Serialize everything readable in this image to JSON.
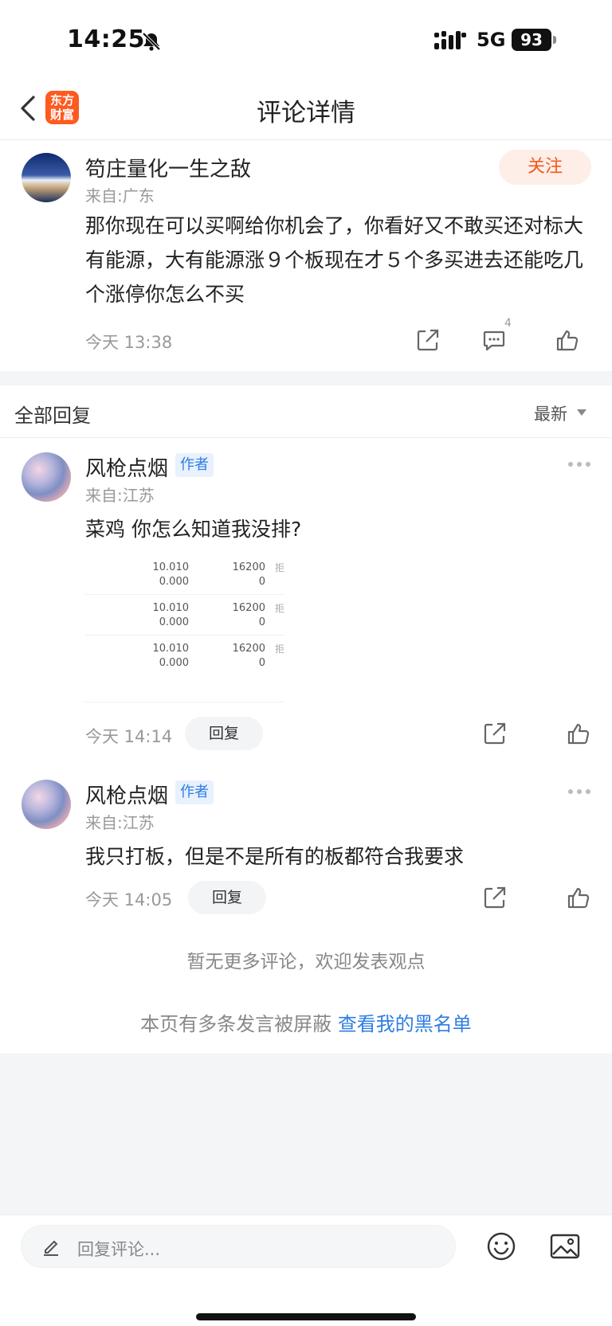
{
  "status_bar": {
    "time": "14:25",
    "network": "5G",
    "battery": "93"
  },
  "nav": {
    "title": "评论详情",
    "logo_line1": "东方",
    "logo_line2": "财富"
  },
  "post": {
    "author": "笱庄量化一生之敌",
    "location": "来自:广东",
    "follow_label": "关注",
    "content": "那你现在可以买啊给你机会了，你看好又不敢买还对标大有能源，大有能源涨９个板现在才５个多买进去还能吃几个涨停你怎么不买",
    "time": "今天 13:38",
    "comment_count": "4"
  },
  "replies_header": {
    "title": "全部回复",
    "sort_label": "最新"
  },
  "replies": [
    {
      "author": "风枪点烟",
      "badge": "作者",
      "location": "来自:江苏",
      "content": "菜鸡 你怎么知道我没排?",
      "time": "今天 14:14",
      "reply_label": "回复",
      "order_rows": [
        {
          "price": "10.010",
          "price_sub": "0.000",
          "volume": "16200",
          "volume_sub": "0",
          "flag": "拒"
        },
        {
          "price": "10.010",
          "price_sub": "0.000",
          "volume": "16200",
          "volume_sub": "0",
          "flag": "拒"
        },
        {
          "price": "10.010",
          "price_sub": "0.000",
          "volume": "16200",
          "volume_sub": "0",
          "flag": "拒"
        }
      ]
    },
    {
      "author": "风枪点烟",
      "badge": "作者",
      "location": "来自:江苏",
      "content": "我只打板，但是不是所有的板都符合我要求",
      "time": "今天 14:05",
      "reply_label": "回复"
    }
  ],
  "footer": {
    "no_more": "暂无更多评论，欢迎发表观点",
    "blocked_text": "本页有多条发言被屏蔽 ",
    "blacklist_link": "查看我的黑名单"
  },
  "bottom_bar": {
    "placeholder": "回复评论..."
  },
  "colors": {
    "accent": "#f25a1c",
    "link": "#2f7de1",
    "logo": "#ff5a1f"
  },
  "icons": [
    "bell-slash-icon",
    "signal-icon",
    "back-icon",
    "share-icon",
    "comment-icon",
    "like-icon",
    "more-icon",
    "pencil-icon",
    "emoji-icon",
    "image-icon"
  ]
}
